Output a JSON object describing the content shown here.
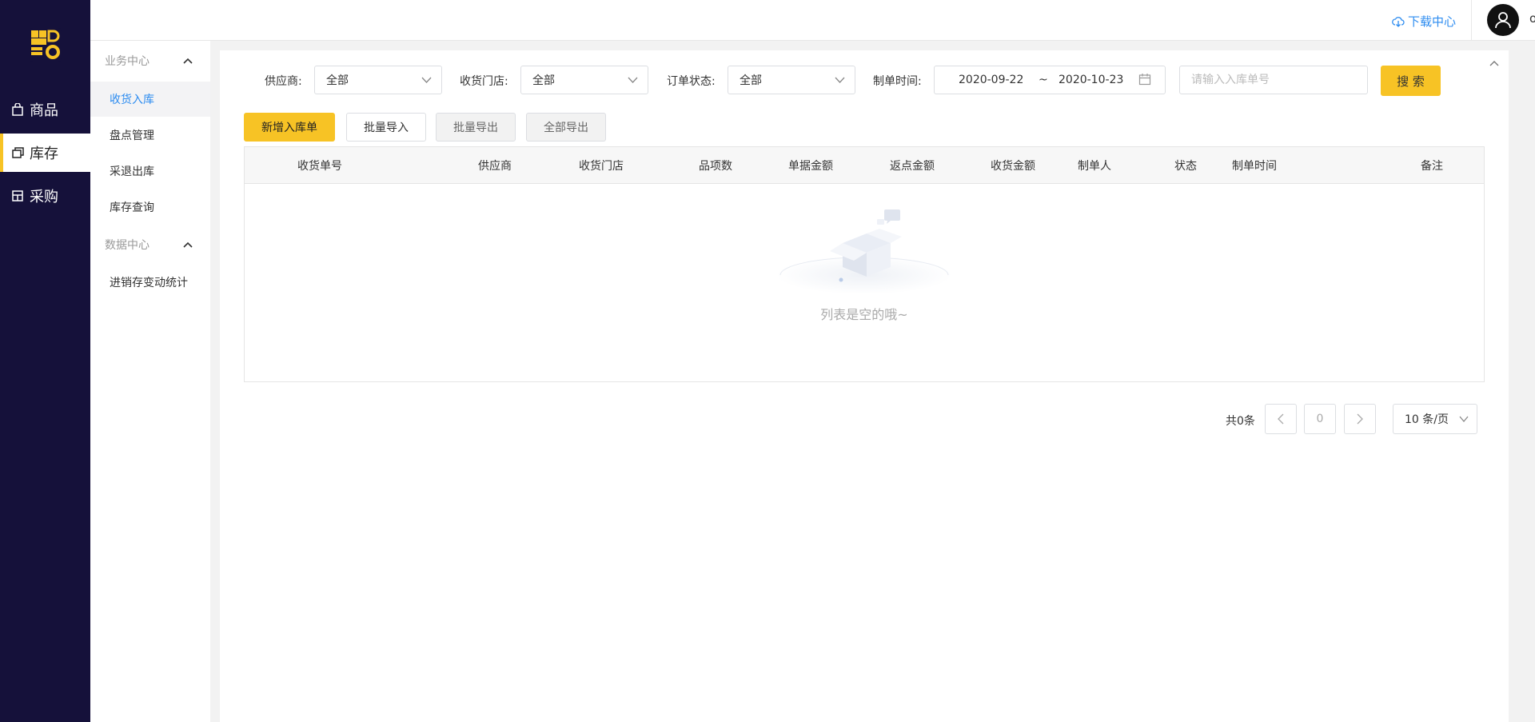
{
  "nav": {
    "items": [
      {
        "label": "商品",
        "icon": "bag-icon"
      },
      {
        "label": "库存",
        "icon": "stack-icon"
      },
      {
        "label": "采购",
        "icon": "purchase-icon"
      }
    ],
    "active_index": 1
  },
  "topbar": {
    "download_label": "下载中心",
    "username": "owner"
  },
  "subnav": {
    "groups": [
      {
        "title": "业务中心",
        "items": [
          "收货入库",
          "盘点管理",
          "采退出库",
          "库存查询"
        ]
      },
      {
        "title": "数据中心",
        "items": [
          "进销存变动统计"
        ]
      }
    ],
    "active_item": "收货入库"
  },
  "filters": {
    "supplier_label": "供应商:",
    "supplier_value": "全部",
    "store_label": "收货门店:",
    "store_value": "全部",
    "status_label": "订单状态:",
    "status_value": "全部",
    "date_label": "制单时间:",
    "date_start": "2020-09-22",
    "date_sep": "~",
    "date_end": "2020-10-23",
    "order_no_placeholder": "请输入入库单号",
    "search_label": "搜 索"
  },
  "actions": {
    "new_label": "新增入库单",
    "import_label": "批量导入",
    "export_label": "批量导出",
    "export_all_label": "全部导出"
  },
  "table": {
    "columns": [
      "收货单号",
      "供应商",
      "收货门店",
      "品项数",
      "单据金额",
      "返点金额",
      "收货金额",
      "制单人",
      "状态",
      "制单时间",
      "备注"
    ],
    "empty_text": "列表是空的哦~"
  },
  "pager": {
    "total_label": "共0条",
    "prev": "<",
    "current_page": "0",
    "next": ">",
    "page_size": "10 条/页"
  },
  "colors": {
    "accent": "#f7c325",
    "nav_bg": "#15113a",
    "link": "#2d8cf0"
  }
}
